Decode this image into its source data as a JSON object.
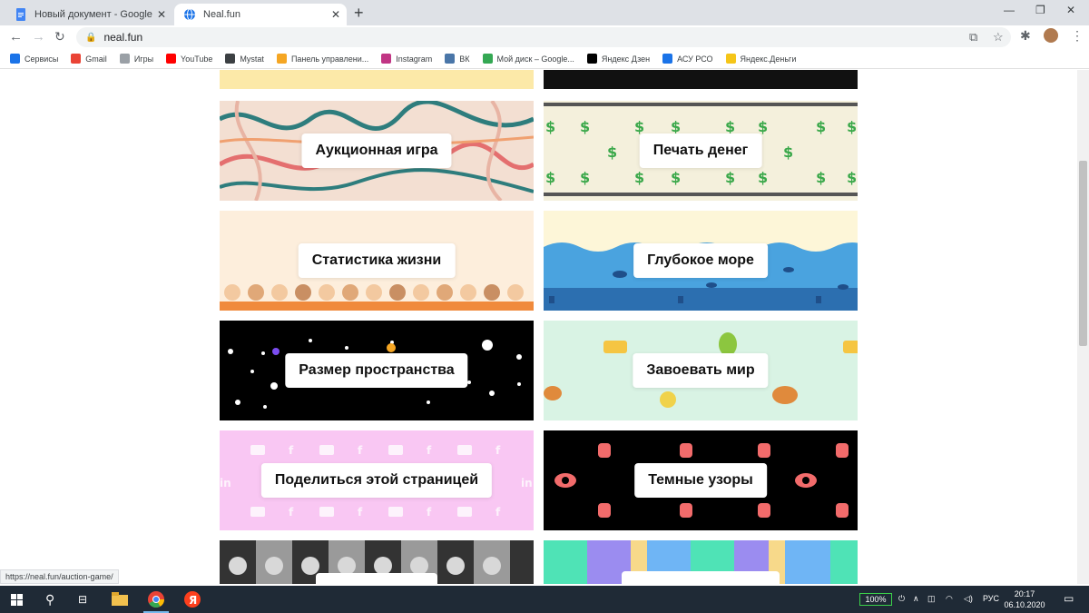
{
  "browser": {
    "tabs": [
      {
        "title": "Новый документ - Google Докум"
      },
      {
        "title": "Neal.fun"
      }
    ],
    "url": "neal.fun",
    "bookmarks": [
      {
        "label": "Сервисы",
        "color": "#1a73e8"
      },
      {
        "label": "Gmail",
        "color": "#ea4335"
      },
      {
        "label": "Игры",
        "color": "#9aa0a6"
      },
      {
        "label": "YouTube",
        "color": "#ff0000"
      },
      {
        "label": "Mystat",
        "color": "#3c4043"
      },
      {
        "label": "Панель управлени...",
        "color": "#f5a623"
      },
      {
        "label": "Instagram",
        "color": "#c13584"
      },
      {
        "label": "ВК",
        "color": "#4a76a8"
      },
      {
        "label": "Мой диск – Google...",
        "color": "#34a853"
      },
      {
        "label": "Яндекс Дзен",
        "color": "#000000"
      },
      {
        "label": "АСУ РСО",
        "color": "#1a73e8"
      },
      {
        "label": "Яндекс.Деньги",
        "color": "#f5c518"
      }
    ]
  },
  "cards": [
    {
      "label": "",
      "bg": "#fce9a8"
    },
    {
      "label": "",
      "bg": "#111111"
    },
    {
      "label": "Аукционная игра",
      "bg": "#f3dfd2"
    },
    {
      "label": "Печать денег",
      "bg": "#f4f0dc"
    },
    {
      "label": "Статистика жизни",
      "bg": "#fdeedc"
    },
    {
      "label": "Глубокое море",
      "bg": "#4aa3df"
    },
    {
      "label": "Размер пространства",
      "bg": "#000000"
    },
    {
      "label": "Завоевать мир",
      "bg": "#d9f3e4"
    },
    {
      "label": "Поделиться этой страницей",
      "bg": "#f9c7f3"
    },
    {
      "label": "Темные узоры",
      "bg": "#000000"
    },
    {
      "label": "",
      "bg": "#9a9a9a"
    },
    {
      "label": "",
      "bg": "#9b8cf0"
    }
  ],
  "status_url": "https://neal.fun/auction-game/",
  "taskbar": {
    "battery": "100%",
    "lang": "РУС",
    "time": "20:17",
    "date": "06.10.2020"
  }
}
